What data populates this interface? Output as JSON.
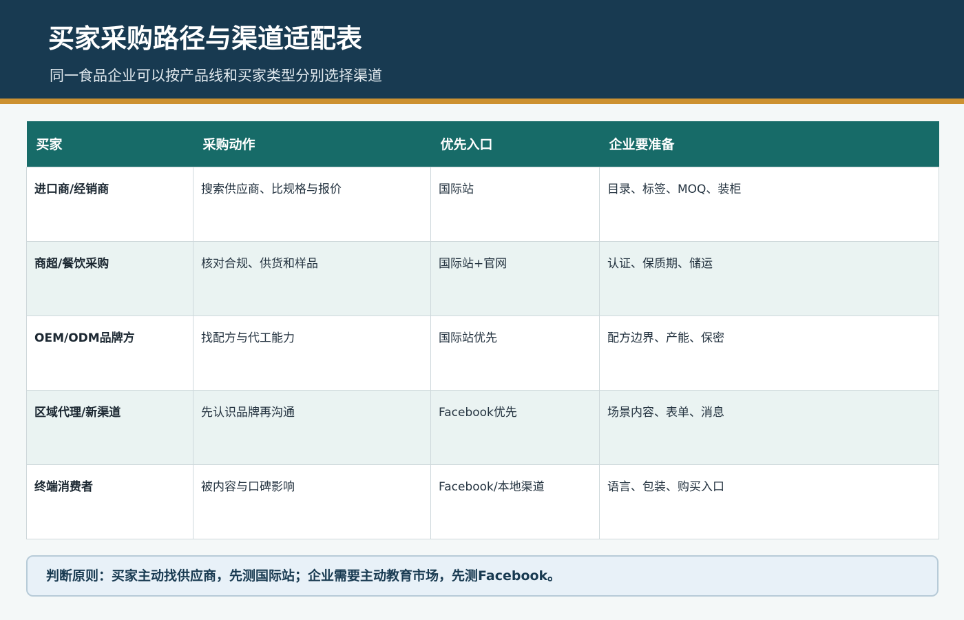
{
  "header": {
    "title": "买家采购路径与渠道适配表",
    "subtitle": "同一食品企业可以按产品线和买家类型分别选择渠道"
  },
  "colors": {
    "header_bg": "#183a51",
    "accent": "#cc9131",
    "table_header_bg": "#176b68",
    "row_alt_bg": "#eaf3f2",
    "principle_bg": "#e8f1f8"
  },
  "table": {
    "columns": [
      "买家",
      "采购动作",
      "优先入口",
      "企业要准备"
    ],
    "rows": [
      {
        "buyer": "进口商/经销商",
        "action": "搜索供应商、比规格与报价",
        "entry": "国际站",
        "prep": "目录、标签、MOQ、装柜"
      },
      {
        "buyer": "商超/餐饮采购",
        "action": "核对合规、供货和样品",
        "entry": "国际站+官网",
        "prep": "认证、保质期、储运"
      },
      {
        "buyer": "OEM/ODM品牌方",
        "action": "找配方与代工能力",
        "entry": "国际站优先",
        "prep": "配方边界、产能、保密"
      },
      {
        "buyer": "区域代理/新渠道",
        "action": "先认识品牌再沟通",
        "entry": "Facebook优先",
        "prep": "场景内容、表单、消息"
      },
      {
        "buyer": "终端消费者",
        "action": "被内容与口碑影响",
        "entry": "Facebook/本地渠道",
        "prep": "语言、包装、购买入口"
      }
    ]
  },
  "principle": "判断原则：买家主动找供应商，先测国际站；企业需要主动教育市场，先测Facebook。"
}
